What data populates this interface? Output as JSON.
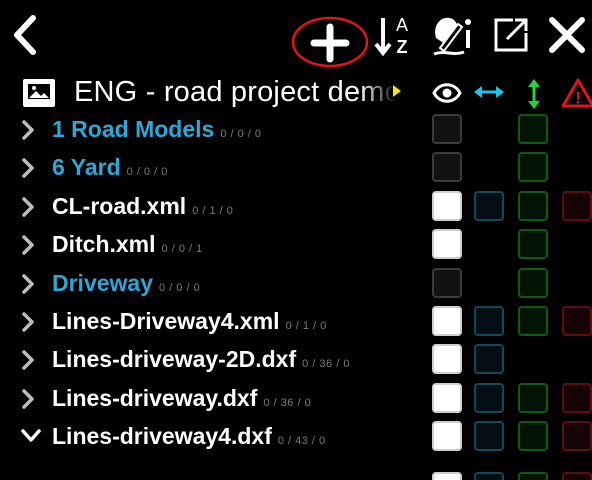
{
  "toolbar": {
    "back_icon": "chevron-left-icon",
    "add_icon": "plus-icon",
    "sort_icon": "sort-az-icon",
    "sort_letters": [
      "A",
      "Z"
    ],
    "edit_icon": "pen-info-icon",
    "open_icon": "open-external-icon",
    "close_icon": "close-icon",
    "highlight_color": "#e0141a"
  },
  "project": {
    "icon": "image-folder-icon",
    "title": "ENG - road project demo"
  },
  "column_headers": {
    "visibility": "eye-icon",
    "horizontal": "horizontal-arrows-icon",
    "vertical": "vertical-arrows-icon",
    "warning": "warning-icon",
    "warning_glyph": "!"
  },
  "rows": [
    {
      "name": "1 Road Models",
      "counts": "0 / 0 / 0",
      "type": "folder",
      "expanded": false,
      "checks": {
        "visible": "dark",
        "horizontal": false,
        "vertical": true,
        "warning": false
      }
    },
    {
      "name": "6 Yard",
      "counts": "0 / 0 / 0",
      "type": "folder",
      "expanded": false,
      "checks": {
        "visible": "dark",
        "horizontal": false,
        "vertical": true,
        "warning": false
      }
    },
    {
      "name": "CL-road.xml",
      "counts": "0 / 1 / 0",
      "type": "file",
      "expanded": false,
      "checks": {
        "visible": "white",
        "horizontal": true,
        "vertical": true,
        "warning": true
      }
    },
    {
      "name": "Ditch.xml",
      "counts": "0 / 0 / 1",
      "type": "file",
      "expanded": false,
      "checks": {
        "visible": "white",
        "horizontal": false,
        "vertical": true,
        "warning": false
      }
    },
    {
      "name": "Driveway",
      "counts": "0 / 0 / 0",
      "type": "folder",
      "expanded": false,
      "checks": {
        "visible": "dark",
        "horizontal": false,
        "vertical": true,
        "warning": false
      }
    },
    {
      "name": "Lines-Driveway4.xml",
      "counts": "0 / 1 / 0",
      "type": "file",
      "expanded": false,
      "checks": {
        "visible": "white",
        "horizontal": true,
        "vertical": true,
        "warning": true
      }
    },
    {
      "name": "Lines-driveway-2D.dxf",
      "counts": "0 / 36 / 0",
      "type": "file",
      "expanded": false,
      "checks": {
        "visible": "white",
        "horizontal": true,
        "vertical": false,
        "warning": false
      }
    },
    {
      "name": "Lines-driveway.dxf",
      "counts": "0 / 36 / 0",
      "type": "file",
      "expanded": false,
      "checks": {
        "visible": "white",
        "horizontal": true,
        "vertical": true,
        "warning": true
      }
    },
    {
      "name": "Lines-driveway4.dxf",
      "counts": "0 / 43 / 0",
      "type": "file",
      "expanded": true,
      "checks": {
        "visible": "white",
        "horizontal": true,
        "vertical": true,
        "warning": true
      }
    }
  ]
}
